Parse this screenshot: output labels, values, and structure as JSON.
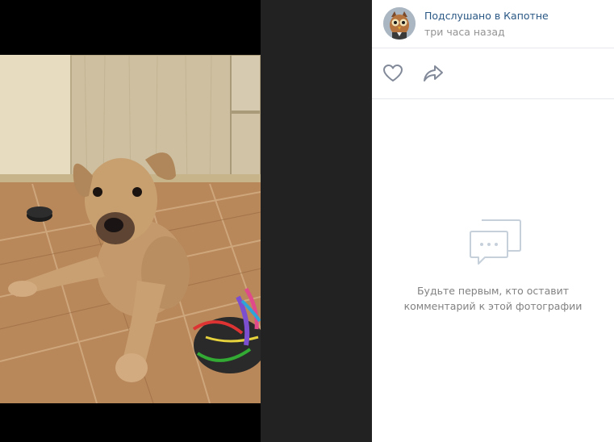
{
  "post": {
    "group_name": "Подслушано в Капотне",
    "time": "три часа назад"
  },
  "actions": {
    "like_icon": "heart-icon",
    "share_icon": "share-arrow-icon"
  },
  "comments": {
    "icon": "comments-bubble-icon",
    "empty_line1": "Будьте первым, кто оставит",
    "empty_line2": "комментарий к этой фотографии"
  },
  "colors": {
    "link": "#2a5885",
    "muted": "#939393",
    "viewer_bg": "#222222",
    "divider": "#e7e8ec"
  }
}
